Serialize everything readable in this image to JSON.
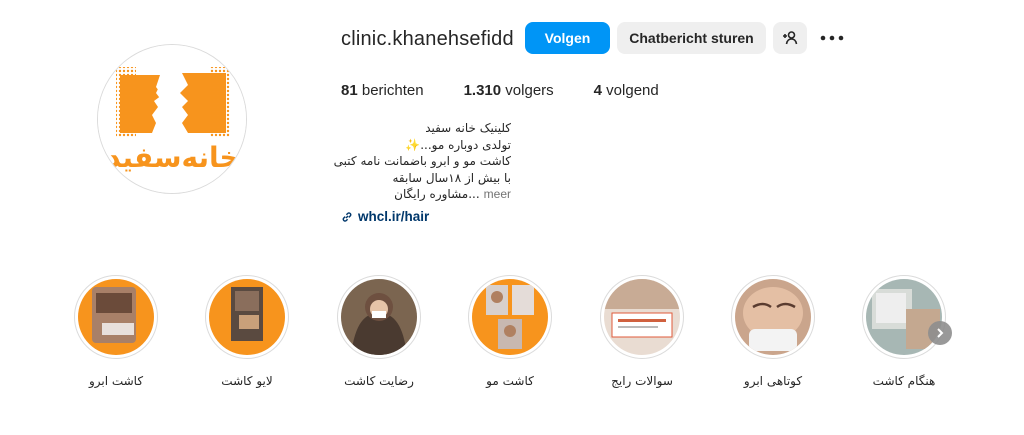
{
  "profile": {
    "username": "clinic.khanehsefidd",
    "follow_label": "Volgen",
    "message_label": "Chatbericht sturen",
    "add_user_icon": "add-user-icon",
    "more_icon": "more-dots-icon",
    "logo_text": "خانه‌سفید",
    "brand_color": "#f7941d"
  },
  "stats": {
    "posts_count": "81",
    "posts_label": "berichten",
    "followers_count": "1.310",
    "followers_label": "volgers",
    "following_count": "4",
    "following_label": "volgend"
  },
  "bio": {
    "line1": "کلینیک خانه سفید",
    "line2": "تولدی دوباره مو...✨",
    "line3": "کاشت مو و ابرو باضمانت نامه کتبی",
    "line4": "با بیش از ۱۸سال سابقه",
    "line5": "...مشاوره رایگان",
    "more_label": "meer",
    "link_text": "whcl.ir/hair"
  },
  "highlights": [
    {
      "label": "کاشت ابرو"
    },
    {
      "label": "لایو کاشت"
    },
    {
      "label": "رضایت کاشت"
    },
    {
      "label": "کاشت مو"
    },
    {
      "label": "سوالات رایج"
    },
    {
      "label": "کوتاهی ابرو"
    },
    {
      "label": "هنگام کاشت"
    }
  ]
}
